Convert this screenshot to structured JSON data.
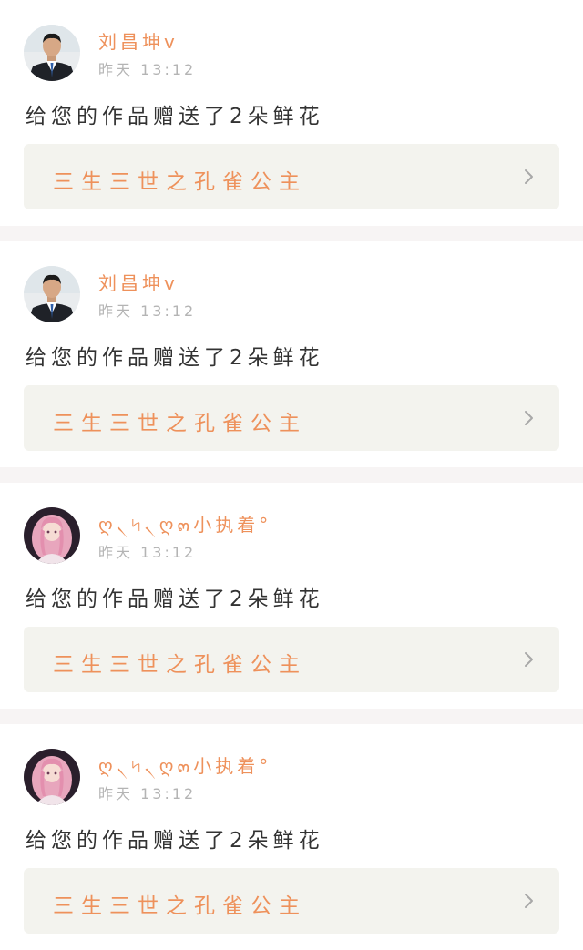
{
  "items": [
    {
      "username": "刘昌坤v",
      "time": "昨天 13:12",
      "message": "给您的作品赠送了2朵鲜花",
      "work_title": "三生三世之孔雀公主",
      "avatar": "man-portrait"
    },
    {
      "username": "刘昌坤v",
      "time": "昨天 13:12",
      "message": "给您的作品赠送了2朵鲜花",
      "work_title": "三生三世之孔雀公主",
      "avatar": "man-portrait"
    },
    {
      "username": "ღ৲৸৲ღ๓小执着°",
      "time": "昨天 13:12",
      "message": "给您的作品赠送了2朵鲜花",
      "work_title": "三生三世之孔雀公主",
      "avatar": "pink-hair-girl"
    },
    {
      "username": "ღ৲৸৲ღ๓小执着°",
      "time": "昨天 13:12",
      "message": "给您的作品赠送了2朵鲜花",
      "work_title": "三生三世之孔雀公主",
      "avatar": "pink-hair-girl"
    }
  ],
  "colors": {
    "accent": "#ee915b",
    "background": "#f7f4f4",
    "card": "#ffffff",
    "link_bg": "#f3f3ee"
  }
}
